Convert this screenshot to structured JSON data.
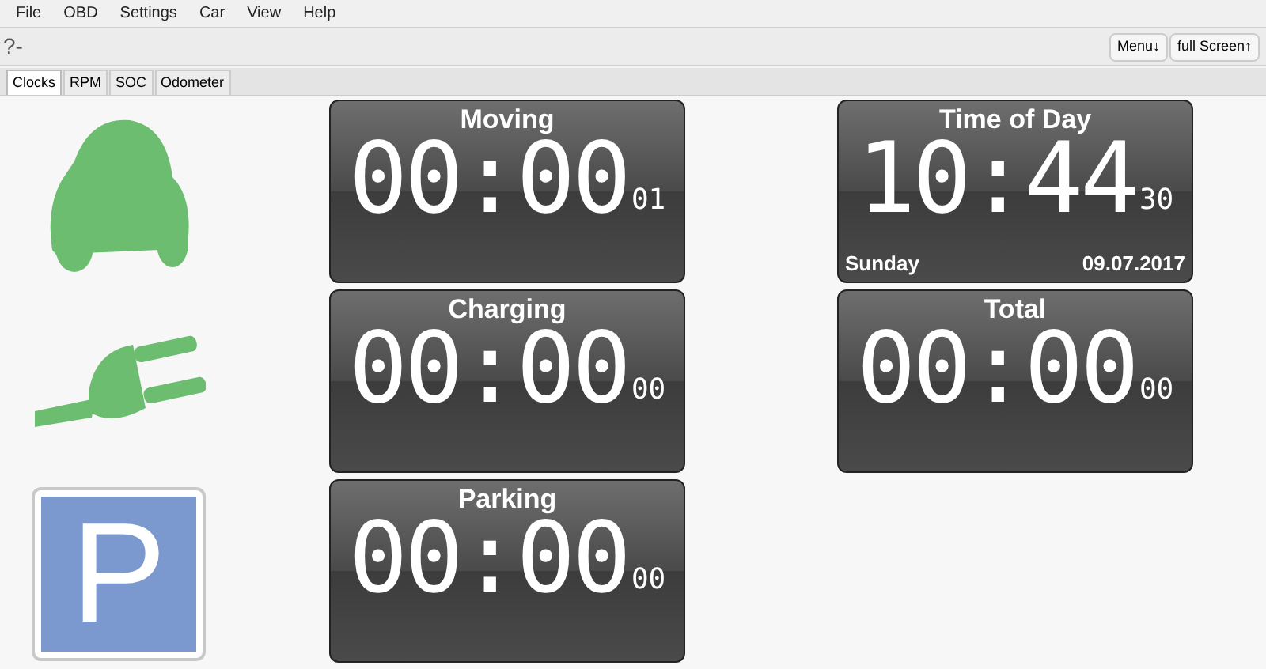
{
  "menu_bar": [
    "File",
    "OBD",
    "Settings",
    "Car",
    "View",
    "Help"
  ],
  "toolbar": {
    "status": "?-",
    "buttons": [
      "Menu↓",
      "full Screen↑"
    ]
  },
  "tabs": [
    {
      "label": "Clocks",
      "selected": true
    },
    {
      "label": "RPM",
      "selected": false
    },
    {
      "label": "SOC",
      "selected": false
    },
    {
      "label": "Odometer",
      "selected": false
    }
  ],
  "icons": [
    {
      "kind": "car"
    },
    {
      "kind": "plug"
    },
    {
      "kind": "parking",
      "label": "P"
    }
  ],
  "clocks_left": [
    {
      "title": "Moving",
      "time": "00:00",
      "seconds": "01"
    },
    {
      "title": "Charging",
      "time": "00:00",
      "seconds": "00"
    },
    {
      "title": "Parking",
      "time": "00:00",
      "seconds": "00"
    }
  ],
  "clocks_right": [
    {
      "title": "Time of Day",
      "time": "10:44",
      "seconds": "30",
      "day": "Sunday",
      "date": "09.07.2017"
    },
    {
      "title": "Total",
      "time": "00:00",
      "seconds": "00"
    }
  ]
}
